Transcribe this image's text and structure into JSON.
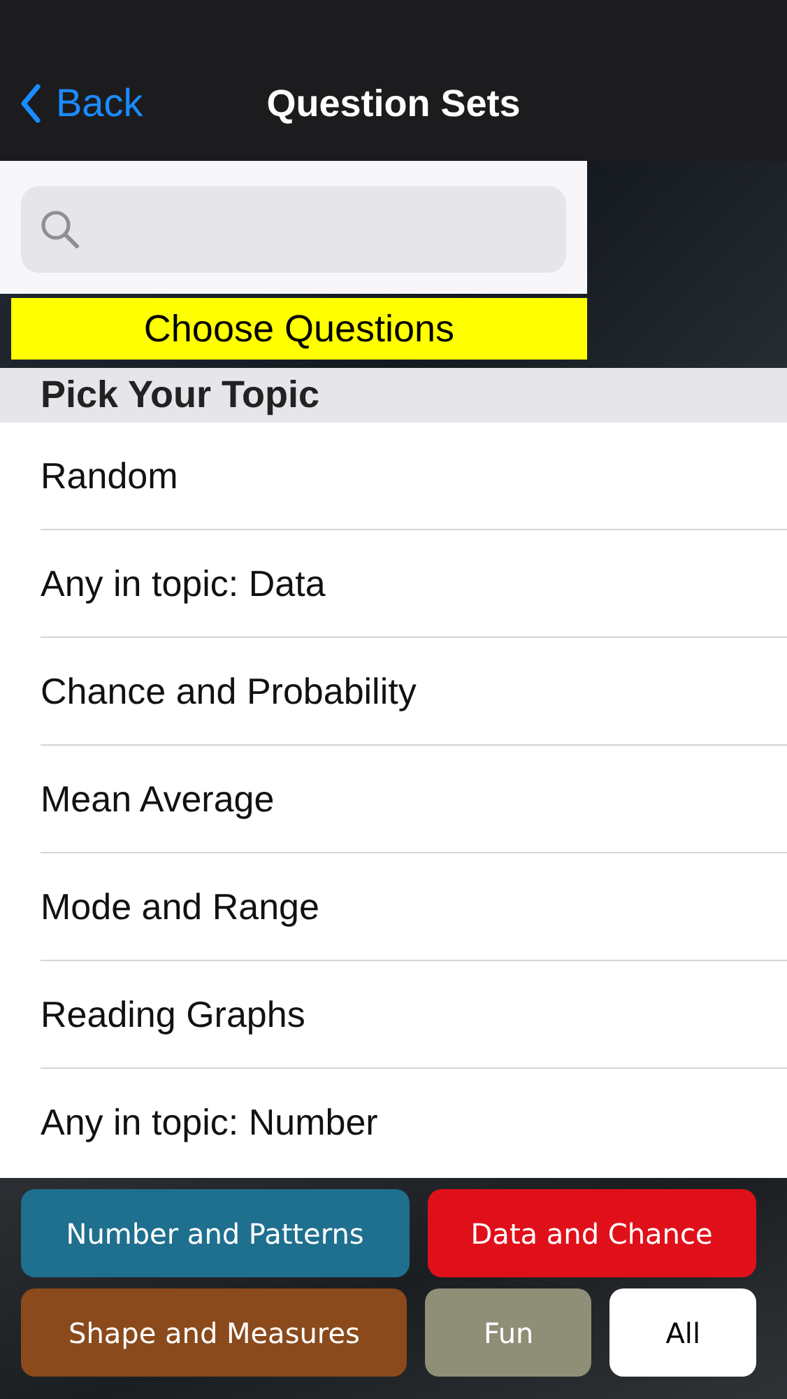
{
  "nav_bar": {
    "back": "Back",
    "title": "Question Sets"
  },
  "choose_button": "Choose Questions",
  "section_header": "Pick Your Topic",
  "topics": [
    {
      "label": "Random"
    },
    {
      "label": "Any in topic: Data"
    },
    {
      "label": "Chance and Probability"
    },
    {
      "label": "Mean Average"
    },
    {
      "label": "Mode and Range"
    },
    {
      "label": "Reading Graphs"
    },
    {
      "label": "Any in topic: Number"
    }
  ],
  "category_rows": [
    [
      {
        "label": "Number and Patterns",
        "color": "#1f6f8f"
      },
      {
        "label": "Data and Chance",
        "color": "#e0101a"
      }
    ],
    [
      {
        "label": "Shape and Measures",
        "color": "#8a4a1c"
      },
      {
        "label": "Fun",
        "color": "#8f8f78"
      },
      {
        "label": "All",
        "color": "#ffffff"
      }
    ]
  ]
}
